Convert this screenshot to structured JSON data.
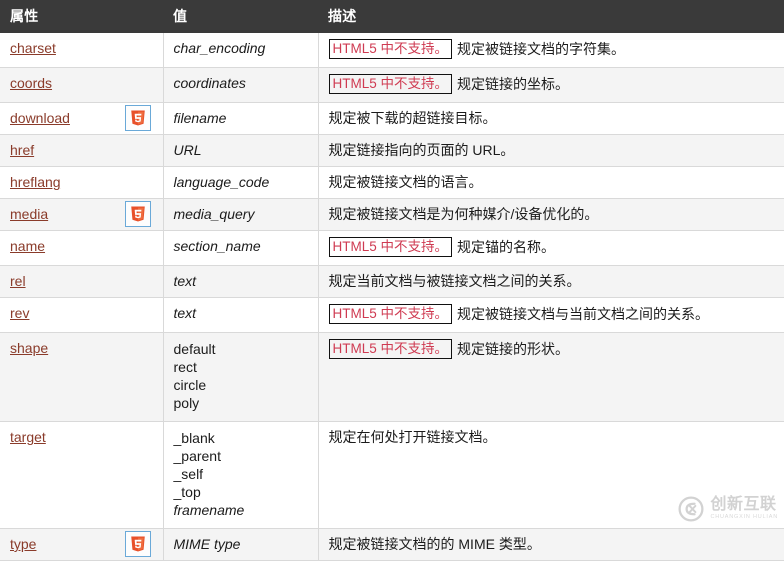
{
  "table": {
    "headers": {
      "attribute": "属性",
      "value": "值",
      "description": "描述"
    },
    "nosupport_label": "HTML5 中不支持。",
    "html5_badge_name": "html5-logo-icon",
    "rows": [
      {
        "attribute": "charset",
        "html5": false,
        "value": "char_encoding",
        "value_style": "italic",
        "nosupport": true,
        "description": "规定被链接文档的字符集。"
      },
      {
        "attribute": "coords",
        "html5": false,
        "value": "coordinates",
        "value_style": "italic",
        "nosupport": true,
        "description": "规定链接的坐标。"
      },
      {
        "attribute": "download",
        "html5": true,
        "value": "filename",
        "value_style": "italic",
        "nosupport": false,
        "description": "规定被下载的超链接目标。"
      },
      {
        "attribute": "href",
        "html5": false,
        "value": "URL",
        "value_style": "italic",
        "nosupport": false,
        "description": "规定链接指向的页面的 URL。"
      },
      {
        "attribute": "hreflang",
        "html5": false,
        "value": "language_code",
        "value_style": "italic",
        "nosupport": false,
        "description": "规定被链接文档的语言。"
      },
      {
        "attribute": "media",
        "html5": true,
        "value": "media_query",
        "value_style": "italic",
        "nosupport": false,
        "description": "规定被链接文档是为何种媒介/设备优化的。"
      },
      {
        "attribute": "name",
        "html5": false,
        "value": "section_name",
        "value_style": "italic",
        "nosupport": true,
        "description": "规定锚的名称。"
      },
      {
        "attribute": "rel",
        "html5": false,
        "value": "text",
        "value_style": "italic",
        "nosupport": false,
        "description": "规定当前文档与被链接文档之间的关系。"
      },
      {
        "attribute": "rev",
        "html5": false,
        "value": "text",
        "value_style": "italic",
        "nosupport": true,
        "description": "规定被链接文档与当前文档之间的关系。"
      },
      {
        "attribute": "shape",
        "html5": false,
        "values": [
          {
            "text": "default",
            "italic": false
          },
          {
            "text": "rect",
            "italic": false
          },
          {
            "text": "circle",
            "italic": false
          },
          {
            "text": "poly",
            "italic": false
          }
        ],
        "nosupport": true,
        "description": "规定链接的形状。",
        "height": "tall"
      },
      {
        "attribute": "target",
        "html5": false,
        "values": [
          {
            "text": "_blank",
            "italic": false
          },
          {
            "text": "_parent",
            "italic": false
          },
          {
            "text": "_self",
            "italic": false
          },
          {
            "text": "_top",
            "italic": false
          },
          {
            "text": "framename",
            "italic": true
          }
        ],
        "nosupport": false,
        "description": "规定在何处打开链接文档。",
        "height": "tall2"
      },
      {
        "attribute": "type",
        "html5": true,
        "value": "MIME type",
        "value_style": "italic",
        "nosupport": false,
        "description": "规定被链接文档的的 MIME 类型。"
      }
    ]
  },
  "watermark": {
    "cn": "创新互联",
    "en": "CHUANGXIN HULIAN"
  },
  "colors": {
    "header_bg": "#3a3a3a",
    "header_text": "#ffffff",
    "link": "#8a3b2a",
    "nosupport_text": "#cf3b52",
    "badge_border": "#6aa9d8",
    "row_alt": "#f4f4f4",
    "border": "#d9d9d9"
  }
}
